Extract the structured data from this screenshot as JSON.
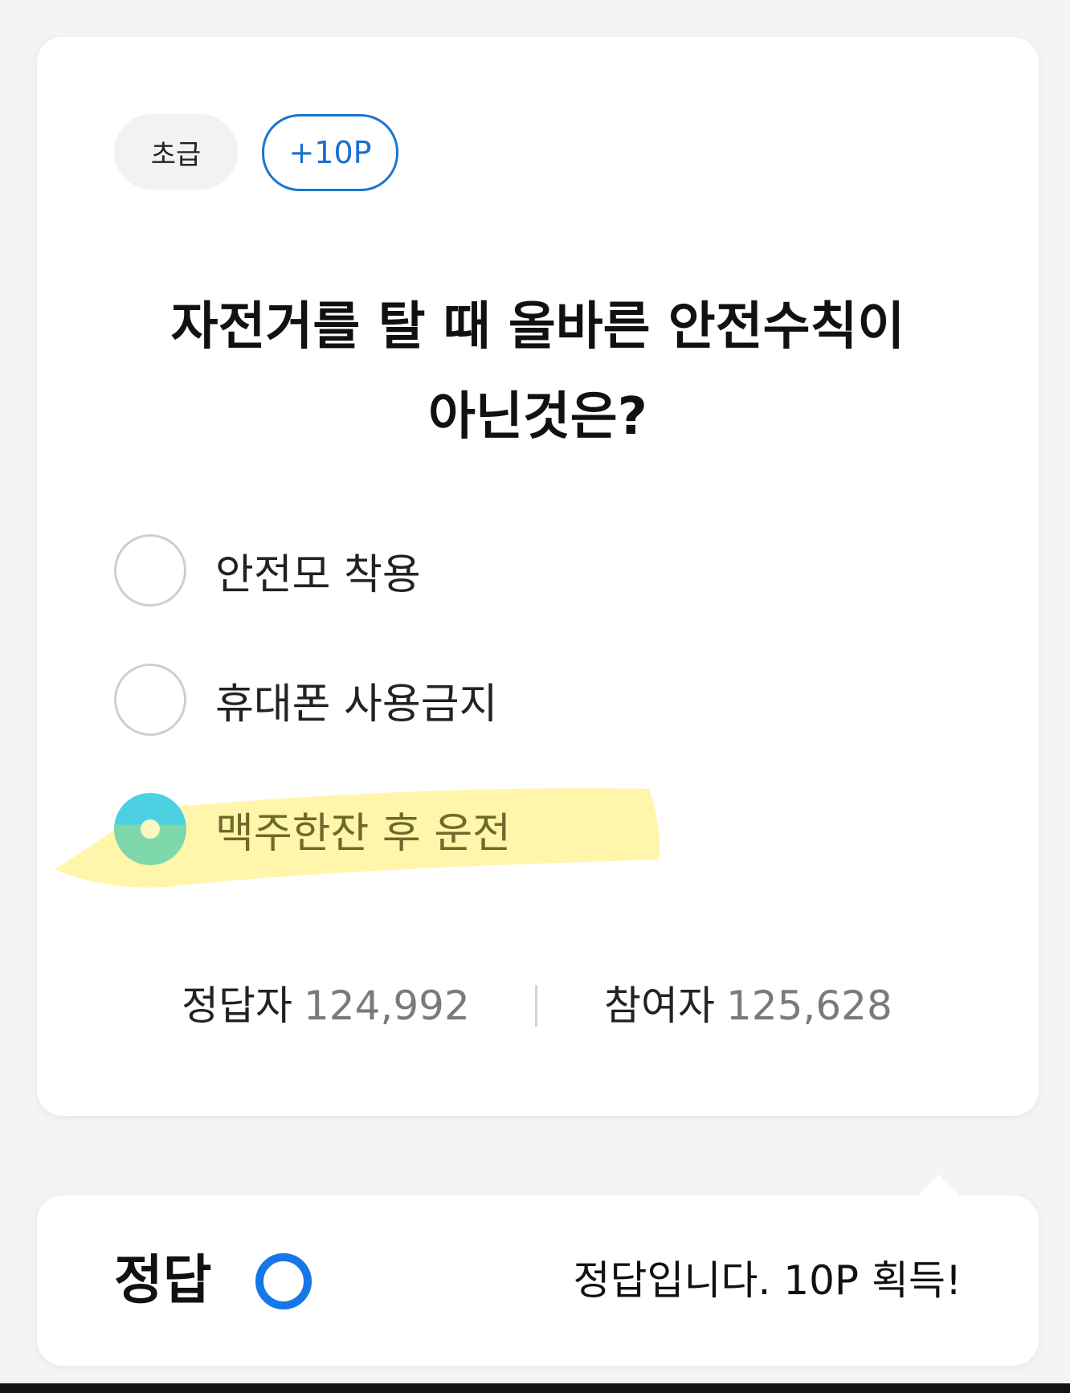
{
  "quiz": {
    "level_badge": "초급",
    "points_badge": "+10P",
    "question_line1": "자전거를 탈 때 올바른 안전수칙이",
    "question_line2": "아닌것은?",
    "options": [
      {
        "label": "안전모 착용",
        "selected": false
      },
      {
        "label": "휴대폰 사용금지",
        "selected": false
      },
      {
        "label": "맥주한잔 후 운전",
        "selected": true
      }
    ],
    "stats": {
      "correct_label": "정답자",
      "correct_value": "124,992",
      "participants_label": "참여자",
      "participants_value": "125,628"
    }
  },
  "result": {
    "title": "정답",
    "icon": "circle-correct-icon",
    "message": "정답입니다. 10P 획득!"
  },
  "colors": {
    "accent_blue": "#1677e8",
    "highlight_yellow": "#fff59d",
    "radio_selected_top": "#4dd0e1",
    "radio_selected_bottom": "#7ed8a9"
  }
}
